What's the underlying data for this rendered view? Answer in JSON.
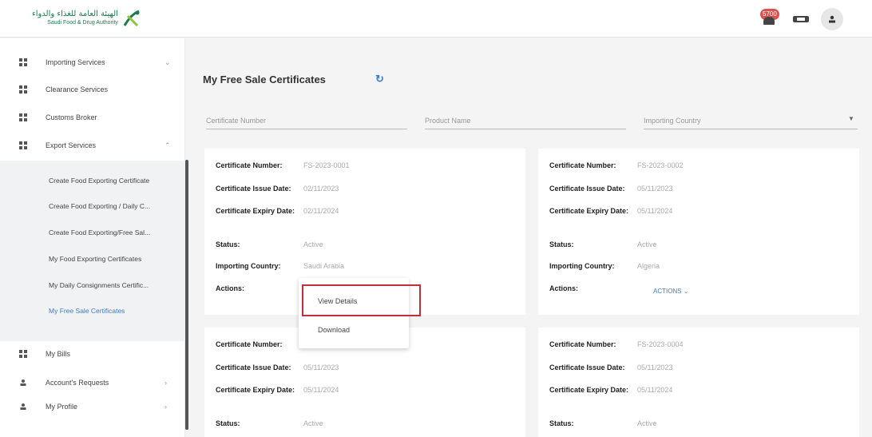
{
  "header": {
    "logo_ar": "الهيئة العامة للغذاء والدواء",
    "logo_en": "Saudi Food & Drug Authority",
    "notification_count": "5700"
  },
  "sidebar": {
    "items": [
      {
        "label": "Importing Services"
      },
      {
        "label": "Clearance Services"
      },
      {
        "label": "Customs Broker"
      },
      {
        "label": "Export Services"
      }
    ],
    "export_sub": [
      {
        "label": "Create Food Exporting Certificate"
      },
      {
        "label": "Create Food Exporting / Daily C..."
      },
      {
        "label": "Create Food Exporting/Free Sal..."
      },
      {
        "label": "My Food Exporting Certificates"
      },
      {
        "label": "My Daily Consignments Certific..."
      },
      {
        "label": "My Free Sale Certificates"
      }
    ],
    "bottom": [
      {
        "label": "My Bills"
      },
      {
        "label": "Account's Requests"
      },
      {
        "label": "My Profile"
      }
    ]
  },
  "main": {
    "title": "My Free Sale Certificates",
    "filters": {
      "certificate_number": "Certificate Number",
      "product_name": "Product Name",
      "importing_country": "Importing Country"
    },
    "labels": {
      "cert_number": "Certificate Number:",
      "issue_date": "Certificate Issue Date:",
      "expiry_date": "Certificate Expiry Date:",
      "status": "Status:",
      "country": "Importing Country:",
      "actions": "Actions:"
    },
    "cards": [
      {
        "number": "FS-2023-0001",
        "issue": "02/11/2023",
        "expiry": "02/11/2024",
        "status": "Active",
        "country": "Saudi Arabia"
      },
      {
        "number": "FS-2023-0002",
        "issue": "05/11/2023",
        "expiry": "05/11/2024",
        "status": "Active",
        "country": "Algeria",
        "actions": "ACTIONS ⌄"
      },
      {
        "number": "",
        "issue": "05/11/2023",
        "expiry": "05/11/2024",
        "status": "Active"
      },
      {
        "number": "FS-2023-0004",
        "issue": "05/11/2023",
        "expiry": "05/11/2024",
        "status": "Active"
      }
    ],
    "menu": {
      "view_details": "View Details",
      "download": "Download"
    }
  }
}
